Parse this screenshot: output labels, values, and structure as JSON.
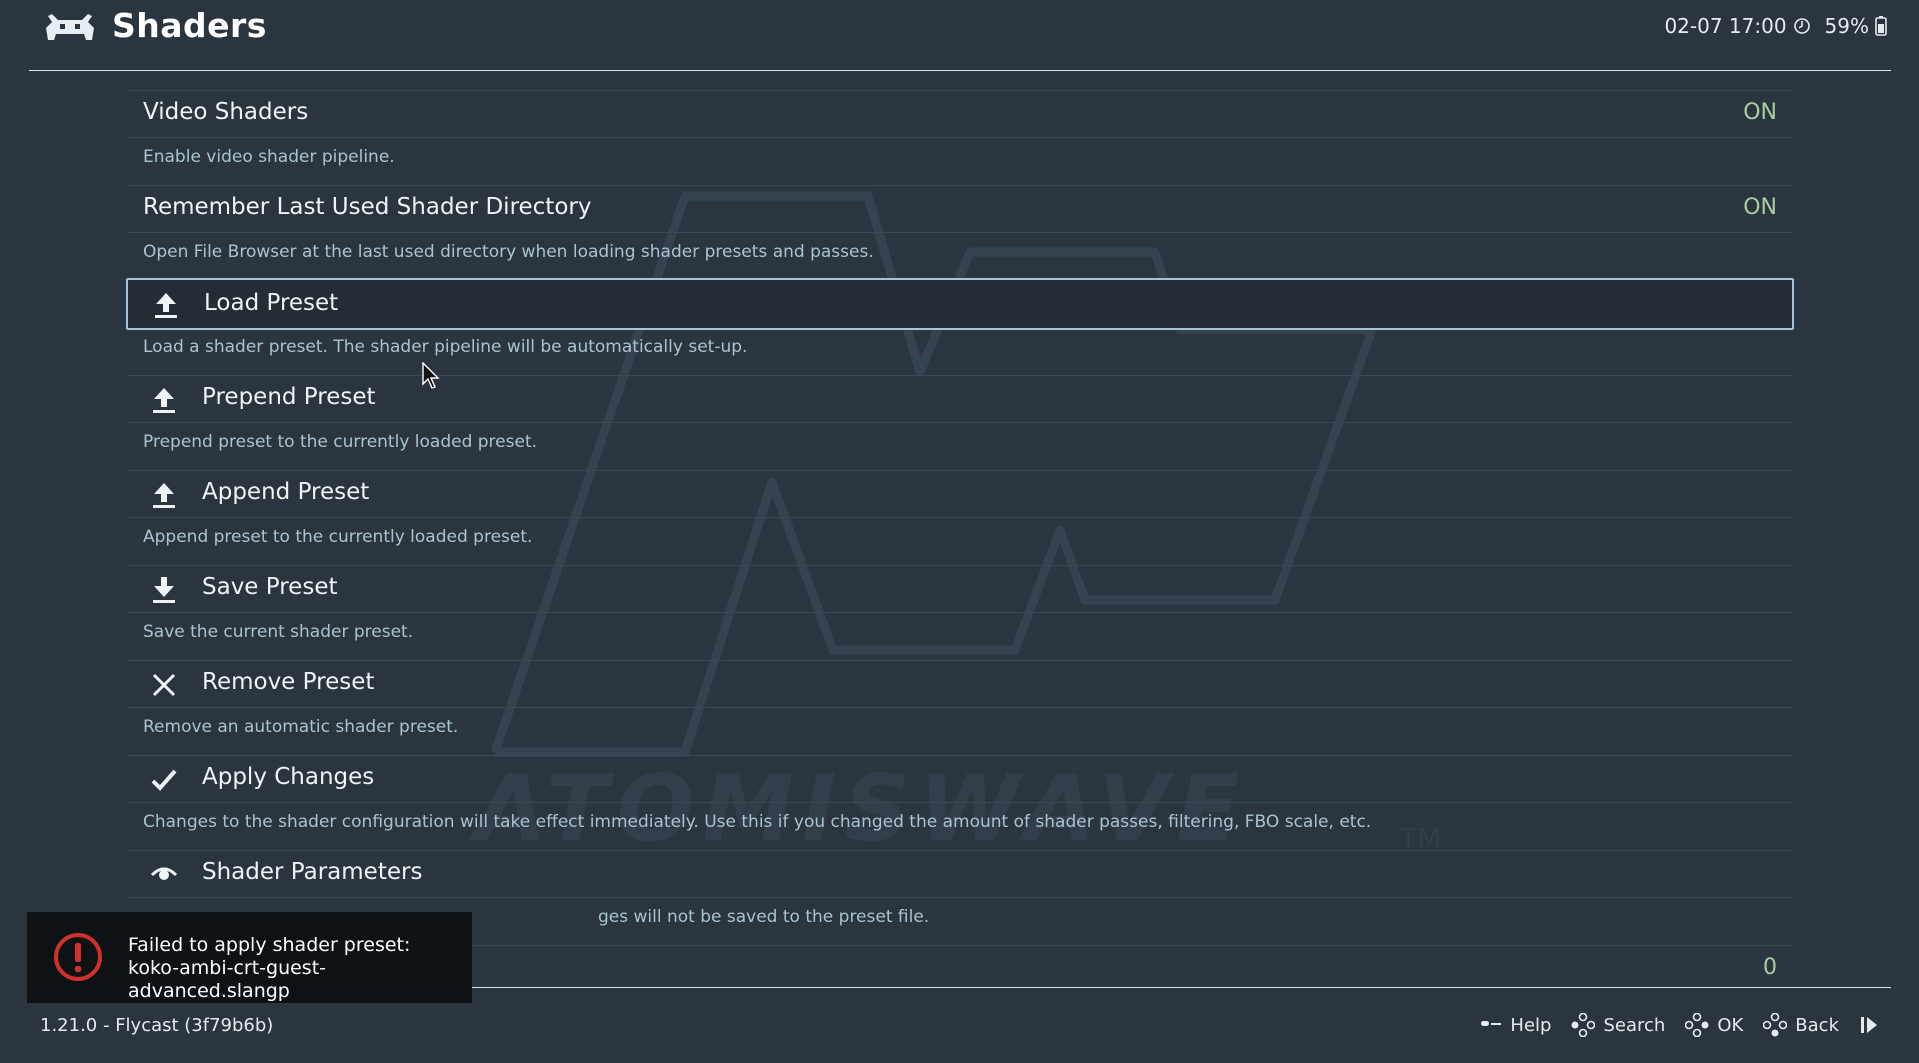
{
  "header": {
    "title": "Shaders",
    "datetime": "02-07 17:00",
    "battery": "59%"
  },
  "menu": {
    "video_shaders": {
      "label": "Video Shaders",
      "value": "ON",
      "desc": "Enable video shader pipeline."
    },
    "remember_dir": {
      "label": "Remember Last Used Shader Directory",
      "value": "ON",
      "desc": "Open File Browser at the last used directory when loading shader presets and passes."
    },
    "load_preset": {
      "label": "Load Preset",
      "icon": "upload-icon",
      "desc": "Load a shader preset. The shader pipeline will be automatically set-up."
    },
    "prepend_preset": {
      "label": "Prepend Preset",
      "icon": "upload-icon",
      "desc": "Prepend preset to the currently loaded preset."
    },
    "append_preset": {
      "label": "Append Preset",
      "icon": "upload-icon",
      "desc": "Append preset to the currently loaded preset."
    },
    "save_preset": {
      "label": "Save Preset",
      "icon": "download-icon",
      "desc": "Save the current shader preset."
    },
    "remove_preset": {
      "label": "Remove Preset",
      "icon": "close-icon",
      "desc": "Remove an automatic shader preset."
    },
    "apply_changes": {
      "label": "Apply Changes",
      "icon": "checkmark-icon",
      "desc": "Changes to the shader configuration will take effect immediately. Use this if you changed the amount of shader passes, filtering, FBO scale, etc."
    },
    "shader_parameters": {
      "label": "Shader Parameters",
      "icon": "eye-icon",
      "desc": "ges will not be saved to the preset file."
    },
    "shader_passes": {
      "value": "0"
    }
  },
  "watermark": {
    "text": "ATOMISWAVE",
    "tm": "TM"
  },
  "toast": {
    "line1": "Failed to apply shader preset:",
    "line2": "koko-ambi-crt-guest-advanced.slangp"
  },
  "footer": {
    "version": "1.21.0 - Flycast (3f79b6b)",
    "help": "Help",
    "search": "Search",
    "ok": "OK",
    "back": "Back"
  },
  "colors": {
    "background": "#2b3540",
    "value_green": "#a9cfa0",
    "description": "#a9c4cf",
    "error_red": "#d0302c"
  }
}
